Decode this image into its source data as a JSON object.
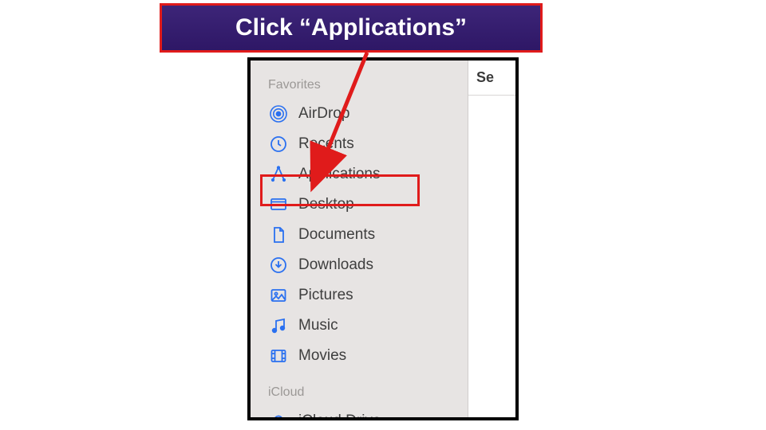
{
  "callout": {
    "text": "Click “Applications”"
  },
  "sidebar": {
    "favorites_label": "Favorites",
    "icloud_label": "iCloud",
    "items": [
      {
        "label": "AirDrop"
      },
      {
        "label": "Recents"
      },
      {
        "label": "Applications"
      },
      {
        "label": "Desktop"
      },
      {
        "label": "Documents"
      },
      {
        "label": "Downloads"
      },
      {
        "label": "Pictures"
      },
      {
        "label": "Music"
      },
      {
        "label": "Movies"
      }
    ],
    "icloud_items": [
      {
        "label": "iCloud Drive"
      }
    ]
  },
  "content": {
    "column_header": "Se"
  },
  "colors": {
    "icon": "#2a70f0",
    "highlight": "#e01b1b"
  }
}
